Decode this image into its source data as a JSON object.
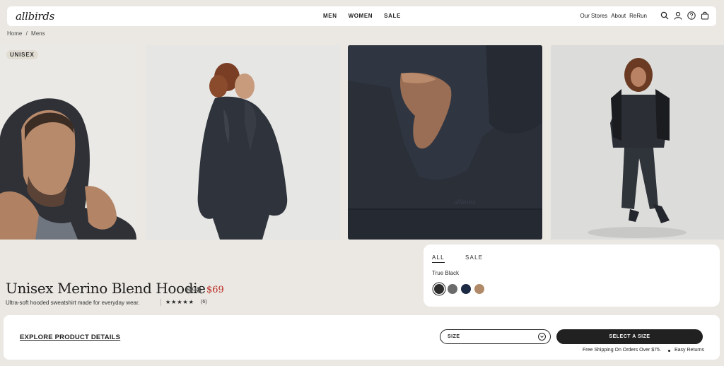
{
  "header": {
    "logo": "allbirds",
    "nav": [
      "MEN",
      "WOMEN",
      "SALE"
    ],
    "utility_links": [
      "Our Stores",
      "About",
      "ReRun"
    ],
    "icons": [
      "search-icon",
      "account-icon",
      "help-icon",
      "cart-icon"
    ]
  },
  "breadcrumb": {
    "items": [
      "Home",
      "/",
      "Mens"
    ]
  },
  "gallery": {
    "badge": "UNISEX",
    "images": [
      "model-in-hood-closeup",
      "model-back-view",
      "pocket-hand-detail",
      "model-full-body-with-vest"
    ]
  },
  "product": {
    "title": "Unisex Merino Blend Hoodie",
    "old_price": "$98",
    "price": "$69",
    "subtitle": "Ultra-soft hooded sweatshirt made for everyday wear.",
    "stars": "★★★★★",
    "review_count": "(6)"
  },
  "colors": {
    "tab_all": "ALL",
    "tab_sale": "SALE",
    "selected_name": "True Black",
    "swatches": [
      "#2c2c2c",
      "#6b6b6b",
      "#1d2a44",
      "#b08a68"
    ]
  },
  "bottom_bar": {
    "explore": "EXPLORE PRODUCT DETAILS",
    "size_label": "SIZE",
    "select_button": "SELECT A SIZE",
    "shipping": "Free Shipping On Orders Over $75.",
    "returns": "Easy Returns"
  }
}
